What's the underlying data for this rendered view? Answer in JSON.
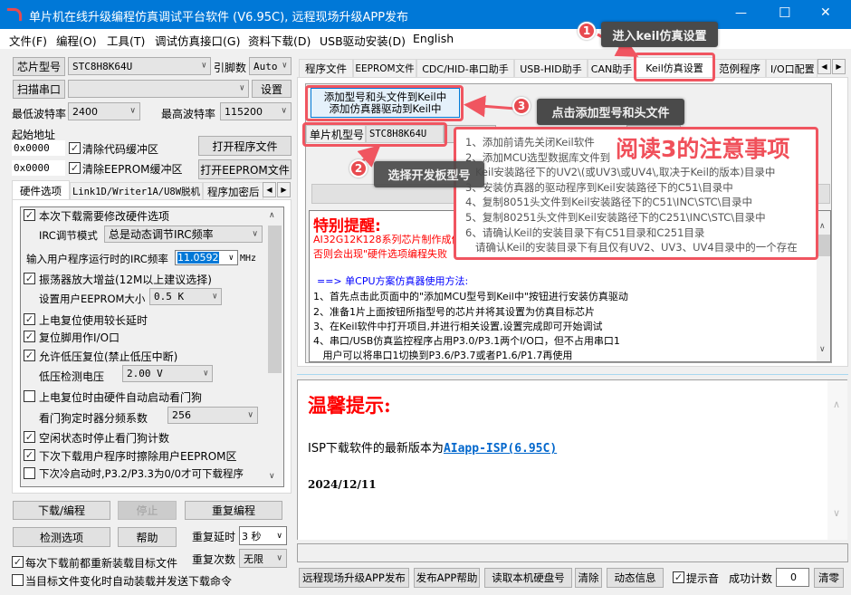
{
  "window": {
    "title": "单片机在线升级编程仿真调试平台软件 (V6.95C), 远程现场升级APP发布",
    "minimize": "—",
    "maximize": "☐",
    "close": "✕"
  },
  "menu": [
    "文件(F)",
    "编程(O)",
    "工具(T)",
    "调试仿真接口(G)",
    "资料下载(D)",
    "USB驱动安装(D)",
    "English"
  ],
  "left": {
    "chip_button": "芯片型号",
    "chip_value": "STC8H8K64U",
    "pins_label": "引脚数",
    "pins_value": "Auto",
    "scan_button": "扫描串口",
    "port_value": "",
    "settings_button": "设置",
    "min_baud_label": "最低波特率",
    "min_baud_value": "2400",
    "max_baud_label": "最高波特率",
    "max_baud_value": "115200",
    "start_addr_label": "起始地址",
    "code_addr": "0x0000",
    "clear_code": "清除代码缓冲区",
    "open_program": "打开程序文件",
    "eeprom_addr": "0x0000",
    "clear_eeprom": "清除EEPROM缓冲区",
    "open_eeprom": "打开EEPROM文件",
    "tabs": [
      "硬件选项",
      "Link1D/Writer1A/U8W脱机",
      "程序加密后"
    ],
    "options": {
      "modify_hw": "本次下载需要修改硬件选项",
      "irc_mode_label": "IRC调节模式",
      "irc_mode_value": "总是动态调节IRC频率",
      "irc_freq_label": "输入用户程序运行时的IRC频率",
      "irc_freq_value": "11.0592",
      "irc_unit": "MHz",
      "osc_gain": "振荡器放大增益(12M以上建议选择)",
      "eeprom_size_label": "设置用户EEPROM大小",
      "eeprom_size_value": "0.5 K",
      "long_delay": "上电复位使用较长延时",
      "reset_io": "复位脚用作I/O口",
      "lvr": "允许低压复位(禁止低压中断)",
      "lvd_label": "低压检测电压",
      "lvd_value": "2.00 V",
      "wdt_hw": "上电复位时由硬件自动启动看门狗",
      "wdt_div_label": "看门狗定时器分频系数",
      "wdt_div_value": "256",
      "idle_wdt": "空闲状态时停止看门狗计数",
      "erase_eeprom": "下次下载用户程序时擦除用户EEPROM区",
      "cold_boot": "下次冷启动时,P3.2/P3.3为0/0才可下载程序"
    },
    "download_button": "下载/编程",
    "stop_button": "停止",
    "repeat_button": "重复编程",
    "check_button": "检测选项",
    "help_button": "帮助",
    "repeat_delay_label": "重复延时",
    "repeat_delay_value": "3 秒",
    "repeat_count_label": "重复次数",
    "repeat_count_value": "无限",
    "reload_each": "每次下载前都重新装载目标文件",
    "auto_load": "当目标文件变化时自动装载并发送下载命令"
  },
  "right": {
    "tabs": [
      "程序文件",
      "EEPROM文件",
      "CDC/HID-串口助手",
      "USB-HID助手",
      "CAN助手",
      "Keil仿真设置",
      "范例程序",
      "I/O口配置"
    ],
    "add_button_line1": "添加型号和头文件到Keil中",
    "add_button_line2": "添加仿真器驱动到Keil中",
    "mcu_label": "单片机型号",
    "mcu_value": "STC8H8K64U",
    "notice_title": "特别提醒:",
    "notice_lines": [
      "AI32G12K128系列芯片制作成仿",
      "否则会出现\"硬件选项编程失败"
    ],
    "usage_title": "==> 单CPU方案仿真器使用方法:",
    "usage_lines": [
      "1、首先点击此页面中的\"添加MCU型号到Keil中\"按钮进行安装仿真驱动",
      "2、准备1片上面按钮所指型号的芯片并将其设置为仿真目标芯片",
      "3、在Keil软件中打开项目,并进行相关设置,设置完成即可开始调试",
      "4、串口/USB仿真监控程序占用P3.0/P3.1两个I/O口，但不占用串口1",
      "   用户可以将串口1切换到P3.6/P3.7或者P1.6/P1.7再使用"
    ],
    "tooltip_title": "阅读3的注意事项",
    "tooltip_lines": [
      "1、添加前请先关闭Keil软件",
      "2、添加MCU选型数据库文件到",
      "   Keil安装路径下的UV2\\(或UV3\\或UV4\\,取决于Keil的版本)目录中",
      "3、安装仿真器的驱动程序到Keil安装路径下的C51\\目录中",
      "4、复制8051头文件到Keil安装路径下的C51\\INC\\STC\\目录中",
      "5、复制80251头文件到Keil安装路径下的C251\\INC\\STC\\目录中",
      "6、请确认Keil的安装目录下有C51目录和C251目录",
      "   请确认Keil的安装目录下有且仅有UV2、UV3、UV4目录中的一个存在"
    ],
    "message": {
      "title": "温馨提示:",
      "line_prefix": "ISP下载软件的最新版本为",
      "link": "AIapp-ISP(6.95C)",
      "date": "2024/12/11"
    },
    "bottom": {
      "publish": "远程现场升级APP发布",
      "publish_help": "发布APP帮助",
      "read_disk": "读取本机硬盘号",
      "clear": "清除",
      "dynamic": "动态信息",
      "beep": "提示音",
      "success_label": "成功计数",
      "success_value": "0",
      "reset": "清零"
    }
  },
  "annotations": {
    "step1": "进入keil仿真设置",
    "step2": "选择开发板型号",
    "step3": "点击添加型号和头文件",
    "n1": "1",
    "n2": "2",
    "n3": "3"
  },
  "colors": {
    "titlebar": "#0078d7",
    "highlight": "#f05560",
    "notice_red": "#ff0000",
    "usage_blue": "#0000ff",
    "link": "#0066cc"
  }
}
